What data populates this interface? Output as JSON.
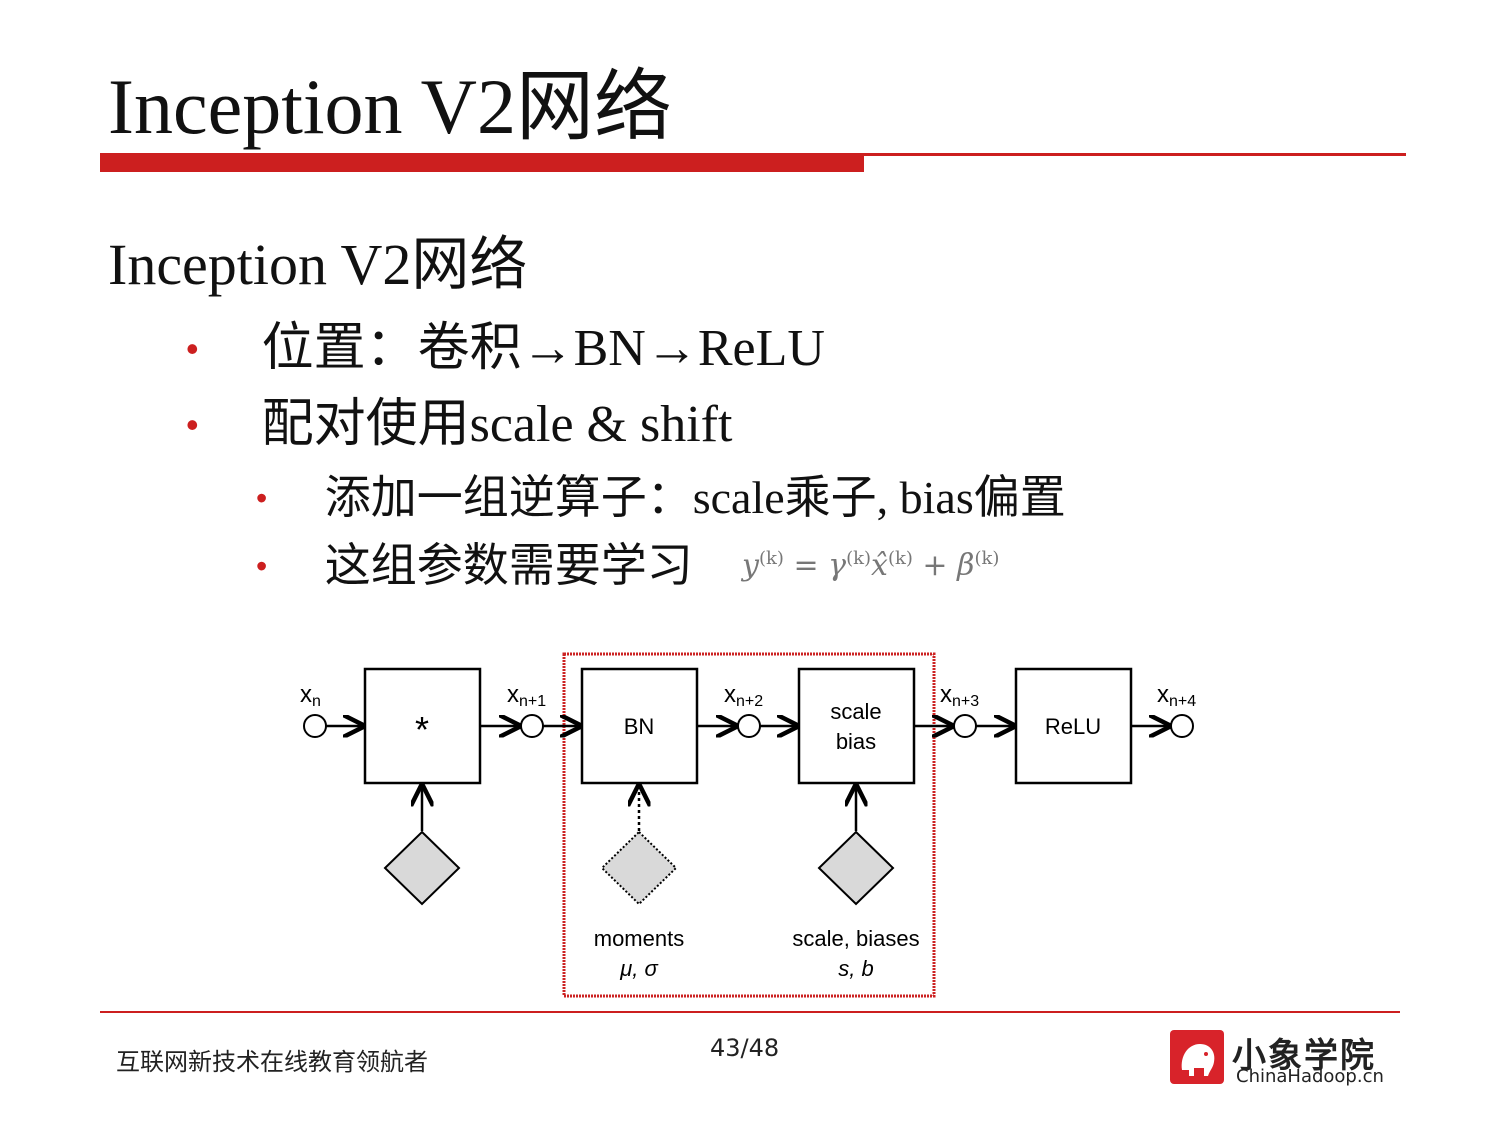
{
  "slide": {
    "title": "Inception V2网络",
    "subheading": "Inception V2网络",
    "bullets": [
      {
        "text": "位置：卷积→BN→ReLU"
      },
      {
        "text": "配对使用scale & shift"
      }
    ],
    "subbullets": [
      {
        "text": "添加一组逆算子：scale乘子, bias偏置"
      },
      {
        "text": "这组参数需要学习"
      }
    ],
    "bullet_symbol": "•",
    "formula": {
      "y": "y",
      "y_sup": "(k)",
      "eq": " = ",
      "gamma": "γ",
      "gamma_sup": "(k)",
      "xhat": "x̂",
      "xhat_sup": "(k)",
      "plus": " + ",
      "beta": "β",
      "beta_sup": "(k)"
    }
  },
  "diagram": {
    "nodes": [
      "x",
      "x",
      "x",
      "x",
      "x"
    ],
    "node_subs": [
      "n",
      "n+1",
      "n+2",
      "n+3",
      "n+4"
    ],
    "conv_label": "*",
    "bn_label": "BN",
    "scale_label_line1": "scale",
    "scale_label_line2": "bias",
    "relu_label": "ReLU",
    "moments_label": "moments",
    "moments_symbols": "μ, σ",
    "scale_params_label": "scale, biases",
    "scale_params_symbols": "s, b",
    "highlight_color": "#cc2222"
  },
  "footer": {
    "tagline": "互联网新技术在线教育领航者",
    "page": "43/48",
    "logo_cn": "小象学院",
    "logo_en": "ChinaHadoop.cn"
  },
  "colors": {
    "accent": "#cc1f1f"
  }
}
